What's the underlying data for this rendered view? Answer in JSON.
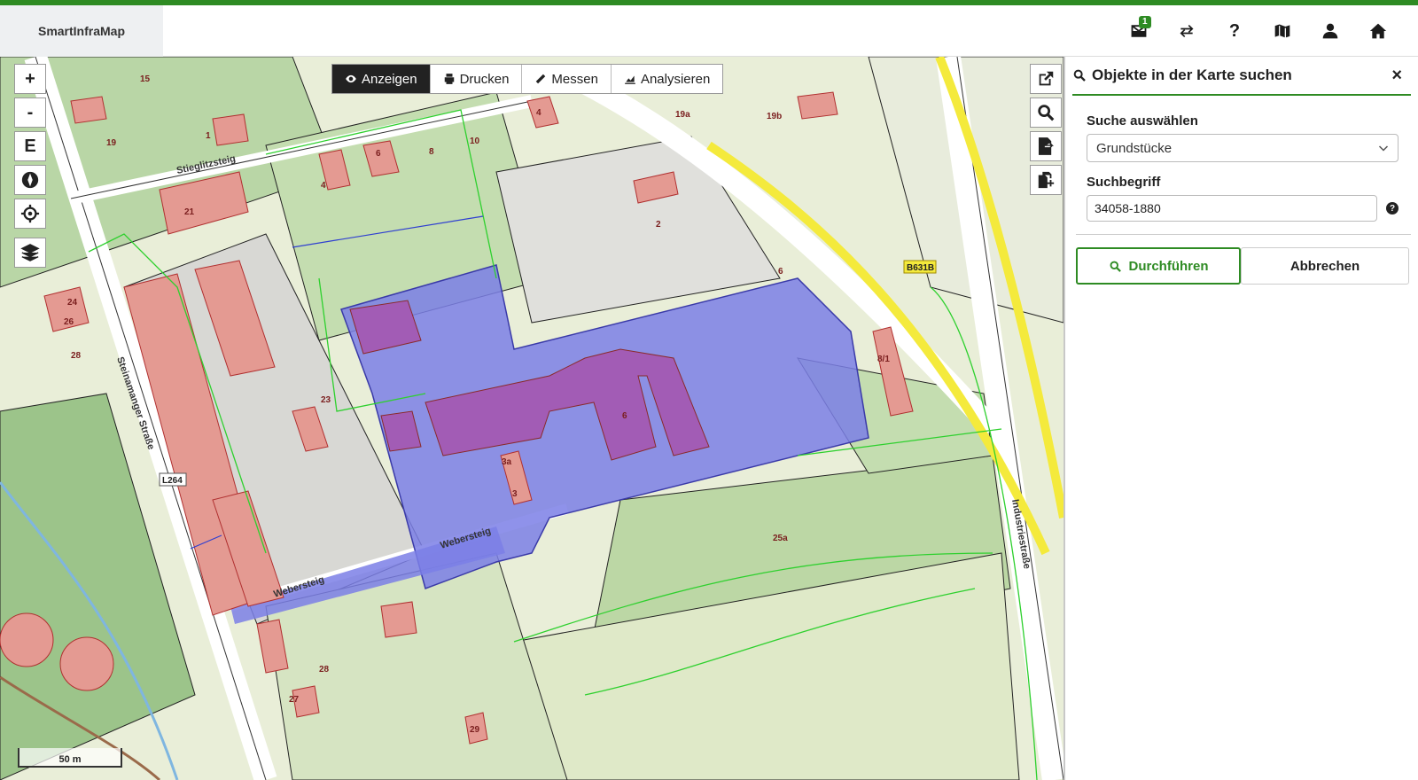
{
  "app": {
    "title": "SmartInfraMap",
    "accent": "#2e8b23",
    "message_count": "1"
  },
  "header_icons": [
    {
      "name": "messages-icon",
      "count": "1"
    },
    {
      "name": "swap-icon"
    },
    {
      "name": "help-icon",
      "glyph": "?"
    },
    {
      "name": "map-icon"
    },
    {
      "name": "user-icon"
    },
    {
      "name": "home-icon"
    }
  ],
  "map_controls": {
    "zoom_in": "+",
    "zoom_out": "-",
    "edit": "E"
  },
  "toolbar": {
    "show": "Anzeigen",
    "print": "Drucken",
    "measure": "Messen",
    "analyze": "Analysieren"
  },
  "scale": {
    "label": "50 m"
  },
  "map_labels": {
    "street_steinamanger": "Steinamanger Straße",
    "street_industrie": "Industriestraße",
    "street_webersteig1": "Webersteig",
    "street_webersteig2": "Webersteig",
    "street_stieglitz": "Stieglitzsteig",
    "road_l264": "L264",
    "road_b631b": "B631B",
    "house_numbers": [
      "15",
      "19",
      "1",
      "21",
      "4",
      "6",
      "8",
      "10",
      "4",
      "2",
      "19a",
      "19b",
      "6",
      "8/1",
      "6",
      "23",
      "3a",
      "3",
      "25a",
      "24",
      "26",
      "28",
      "27",
      "29",
      "28"
    ]
  },
  "panel": {
    "title": "Objekte in der Karte suchen",
    "close": "×",
    "select_label": "Suche auswählen",
    "select_value": "Grundstücke",
    "term_label": "Suchbegriff",
    "term_value": "34058-1880",
    "help": "?",
    "execute": "Durchführen",
    "cancel": "Abbrechen"
  }
}
